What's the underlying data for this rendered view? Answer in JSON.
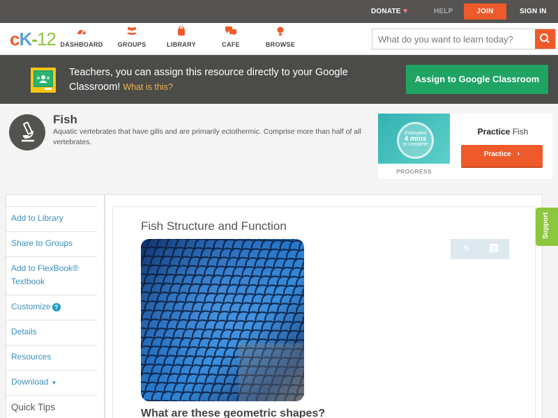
{
  "topbar": {
    "donate": "DONATE",
    "help": "HELP",
    "join": "JOIN",
    "signin": "SIGN IN"
  },
  "logo": {
    "c": "c",
    "k": "K",
    "dash": "-",
    "num": "12"
  },
  "nav": {
    "items": [
      {
        "label": "DASHBOARD",
        "icon": "dashboard-icon"
      },
      {
        "label": "GROUPS",
        "icon": "groups-icon"
      },
      {
        "label": "LIBRARY",
        "icon": "library-icon"
      },
      {
        "label": "CAFE",
        "icon": "cafe-icon"
      },
      {
        "label": "BROWSE",
        "icon": "browse-icon"
      }
    ],
    "search_placeholder": "What do you want to learn today?"
  },
  "teacher": {
    "message": "Teachers, you can assign this resource directly to your Google Classroom!",
    "what_link": "What is this?",
    "assign_button": "Assign to Google Classroom"
  },
  "concept": {
    "title": "Fish",
    "description": "Aquatic vertebrates that have gills and are primarily ectothermic. Comprise more than half of all vertebrates."
  },
  "practice": {
    "estimated": "Estimated",
    "mins": "4 mins",
    "to_complete": "to complete",
    "progress": "PROGRESS",
    "title_bold": "Practice",
    "title_rest": "Fish",
    "button": "Practice"
  },
  "sidebar": {
    "items": [
      "Add to Library",
      "Share to Groups",
      "Add to FlexBook® Textbook",
      "Customize",
      "Details",
      "Resources",
      "Download"
    ],
    "quick_tips": "Quick Tips"
  },
  "article": {
    "title": "Fish Structure and Function",
    "question": "What are these geometric shapes?"
  },
  "support": "Support",
  "colors": {
    "accent": "#ef5a2a",
    "link": "#3a8fbd",
    "google_green": "#1fa463",
    "support_green": "#8dc63f"
  }
}
